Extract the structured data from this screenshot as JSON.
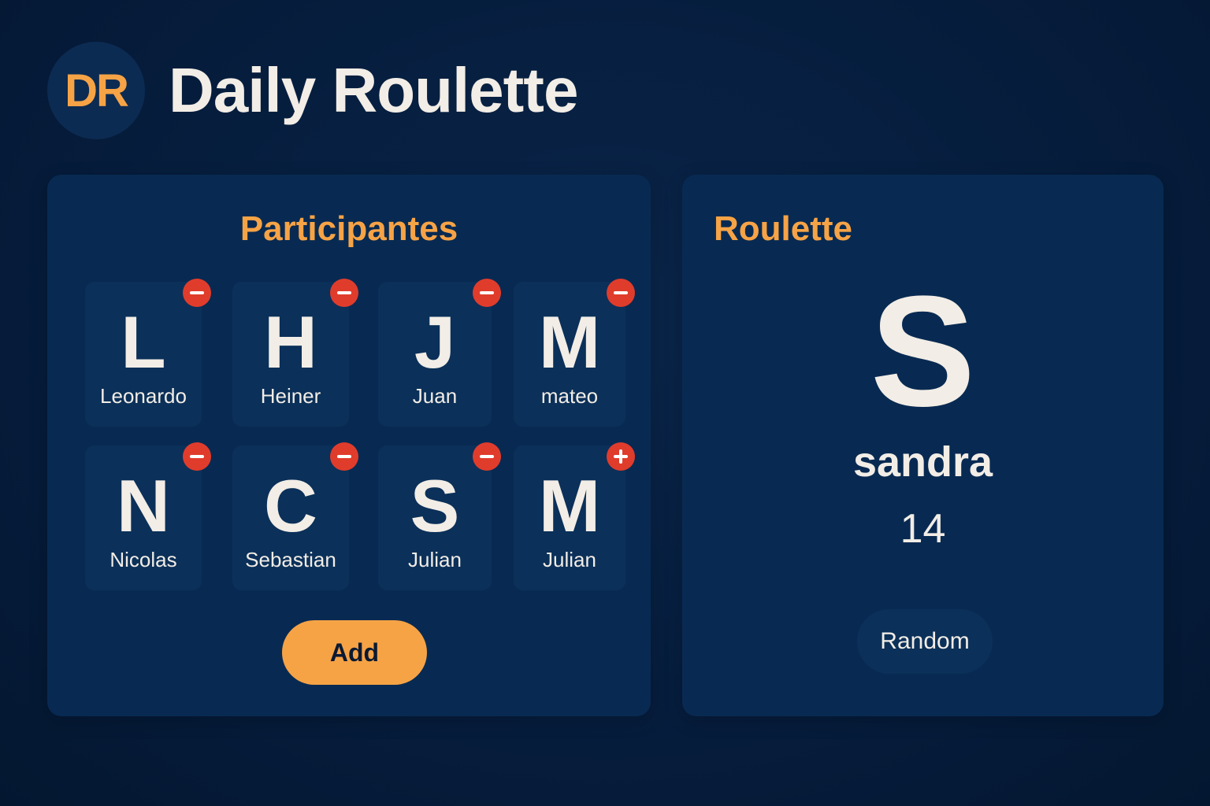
{
  "app": {
    "logo_text": "DR",
    "title": "Daily Roulette"
  },
  "participants": {
    "title": "Participantes",
    "items": [
      {
        "letter": "L",
        "name": "Leonardo",
        "action": "remove"
      },
      {
        "letter": "H",
        "name": "Heiner",
        "action": "remove"
      },
      {
        "letter": "J",
        "name": "Juan",
        "action": "remove"
      },
      {
        "letter": "M",
        "name": "mateo",
        "action": "remove"
      },
      {
        "letter": "N",
        "name": "Nicolas",
        "action": "remove"
      },
      {
        "letter": "C",
        "name": "Sebastian",
        "action": "remove"
      },
      {
        "letter": "S",
        "name": "Julian",
        "action": "remove"
      },
      {
        "letter": "M",
        "name": "Julian",
        "action": "add"
      }
    ],
    "add_label": "Add"
  },
  "roulette": {
    "title": "Roulette",
    "selected_letter": "S",
    "selected_name": "sandra",
    "selected_number": "14",
    "random_label": "Random"
  },
  "colors": {
    "background": "#061d3d",
    "panel": "#082a52",
    "accent": "#f6a346",
    "badge": "#e03c2c",
    "text": "#f2ede6"
  }
}
